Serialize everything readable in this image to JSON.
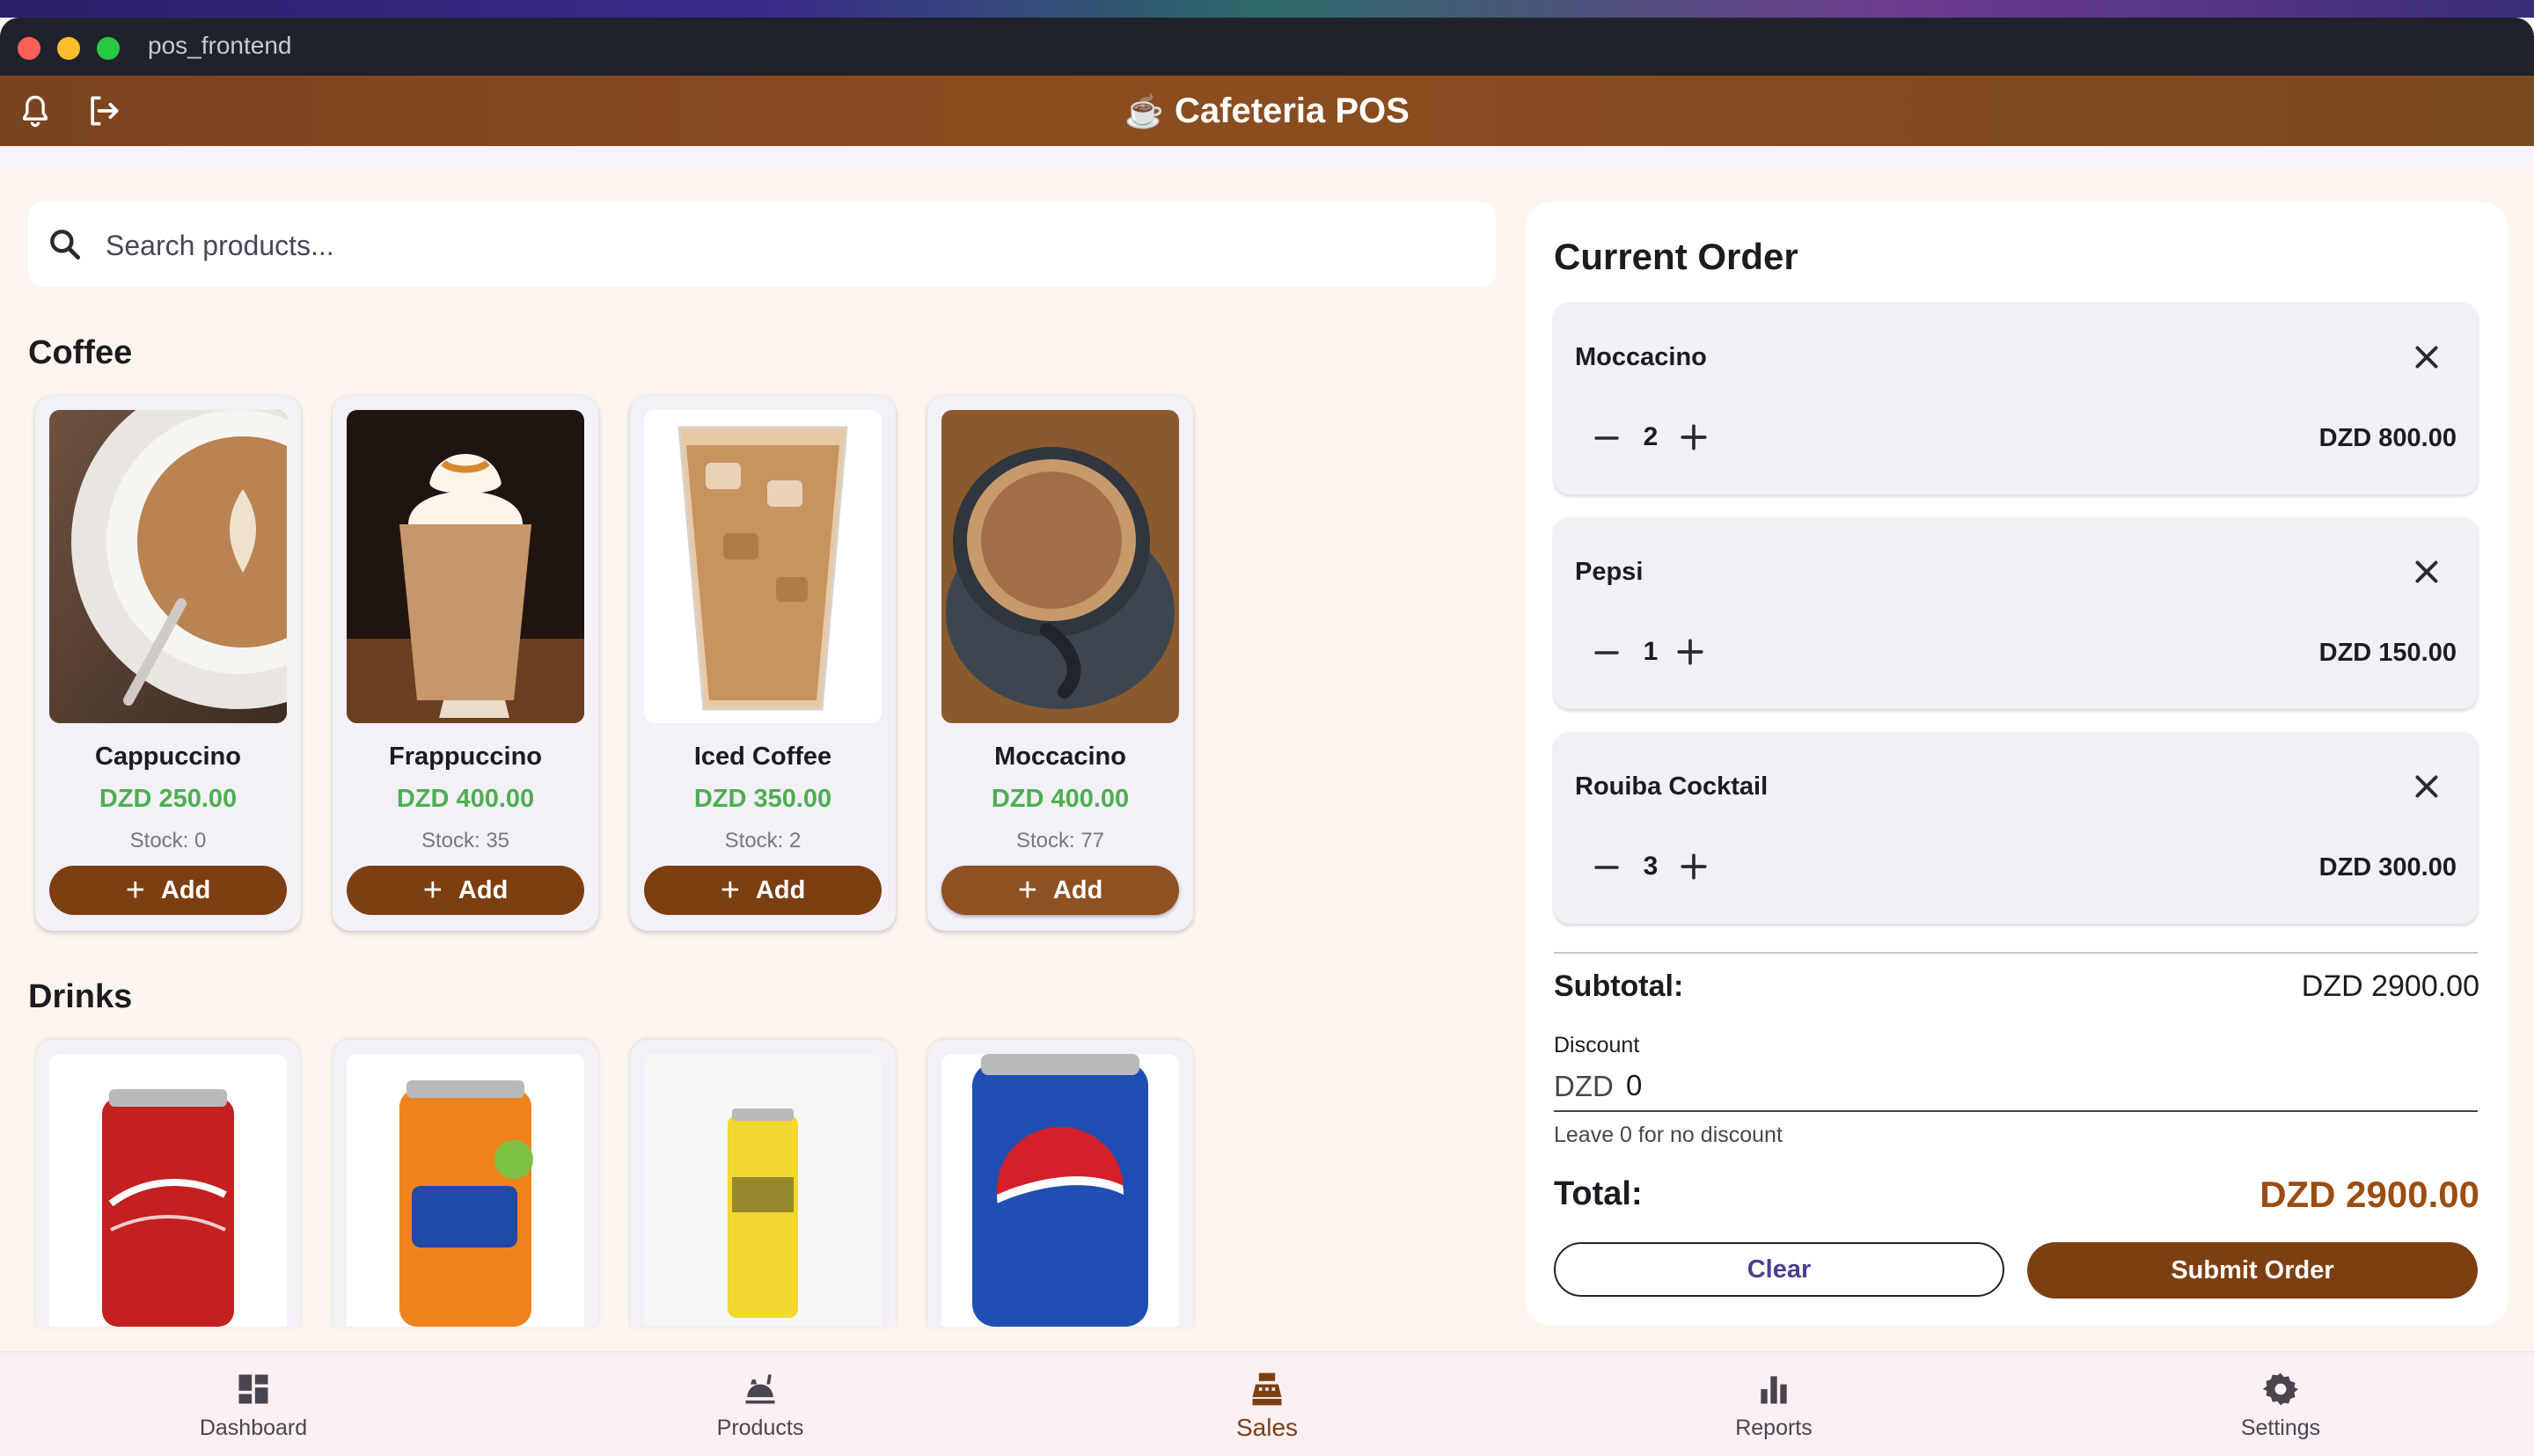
{
  "window": {
    "title": "pos_frontend"
  },
  "appbar": {
    "title": "Cafeteria POS",
    "cup_glyph": "☕",
    "icons": [
      "bell-icon",
      "logout-icon"
    ]
  },
  "search": {
    "placeholder": "Search products...",
    "value": ""
  },
  "categories": [
    {
      "title": "Coffee",
      "products": [
        {
          "name": "Cappuccino",
          "price": "DZD 250.00",
          "stock": "Stock: 0",
          "add_label": "Add"
        },
        {
          "name": "Frappuccino",
          "price": "DZD 400.00",
          "stock": "Stock: 35",
          "add_label": "Add"
        },
        {
          "name": "Iced Coffee",
          "price": "DZD 350.00",
          "stock": "Stock: 2",
          "add_label": "Add"
        },
        {
          "name": "Moccacino",
          "price": "DZD 400.00",
          "stock": "Stock: 77",
          "add_label": "Add"
        }
      ]
    },
    {
      "title": "Drinks",
      "products": [
        {
          "image": "coca-cola-can"
        },
        {
          "image": "fanta-can"
        },
        {
          "image": "hamoud-can"
        },
        {
          "image": "pepsi-can"
        }
      ]
    }
  ],
  "order": {
    "title": "Current Order",
    "items": [
      {
        "name": "Moccacino",
        "qty": "2",
        "total": "DZD 800.00"
      },
      {
        "name": "Pepsi",
        "qty": "1",
        "total": "DZD 150.00"
      },
      {
        "name": "Rouiba Cocktail",
        "qty": "3",
        "total": "DZD 300.00"
      }
    ],
    "subtotal_label": "Subtotal:",
    "subtotal_value": "DZD 2900.00",
    "discount_label": "Discount",
    "discount_prefix": "DZD",
    "discount_value": "0",
    "discount_help": "Leave 0 for no discount",
    "total_label": "Total:",
    "total_value": "DZD 2900.00",
    "clear_label": "Clear",
    "submit_label": "Submit Order"
  },
  "nav": [
    {
      "label": "Dashboard",
      "icon": "dashboard-icon",
      "active": false
    },
    {
      "label": "Products",
      "icon": "products-icon",
      "active": false
    },
    {
      "label": "Sales",
      "icon": "sales-register-icon",
      "active": true
    },
    {
      "label": "Reports",
      "icon": "reports-icon",
      "active": false
    },
    {
      "label": "Settings",
      "icon": "settings-icon",
      "active": false
    }
  ],
  "colors": {
    "brand": "#7c3f12",
    "price": "#4caf50",
    "total": "#9a4e12",
    "clear_text": "#4a3f8f"
  }
}
